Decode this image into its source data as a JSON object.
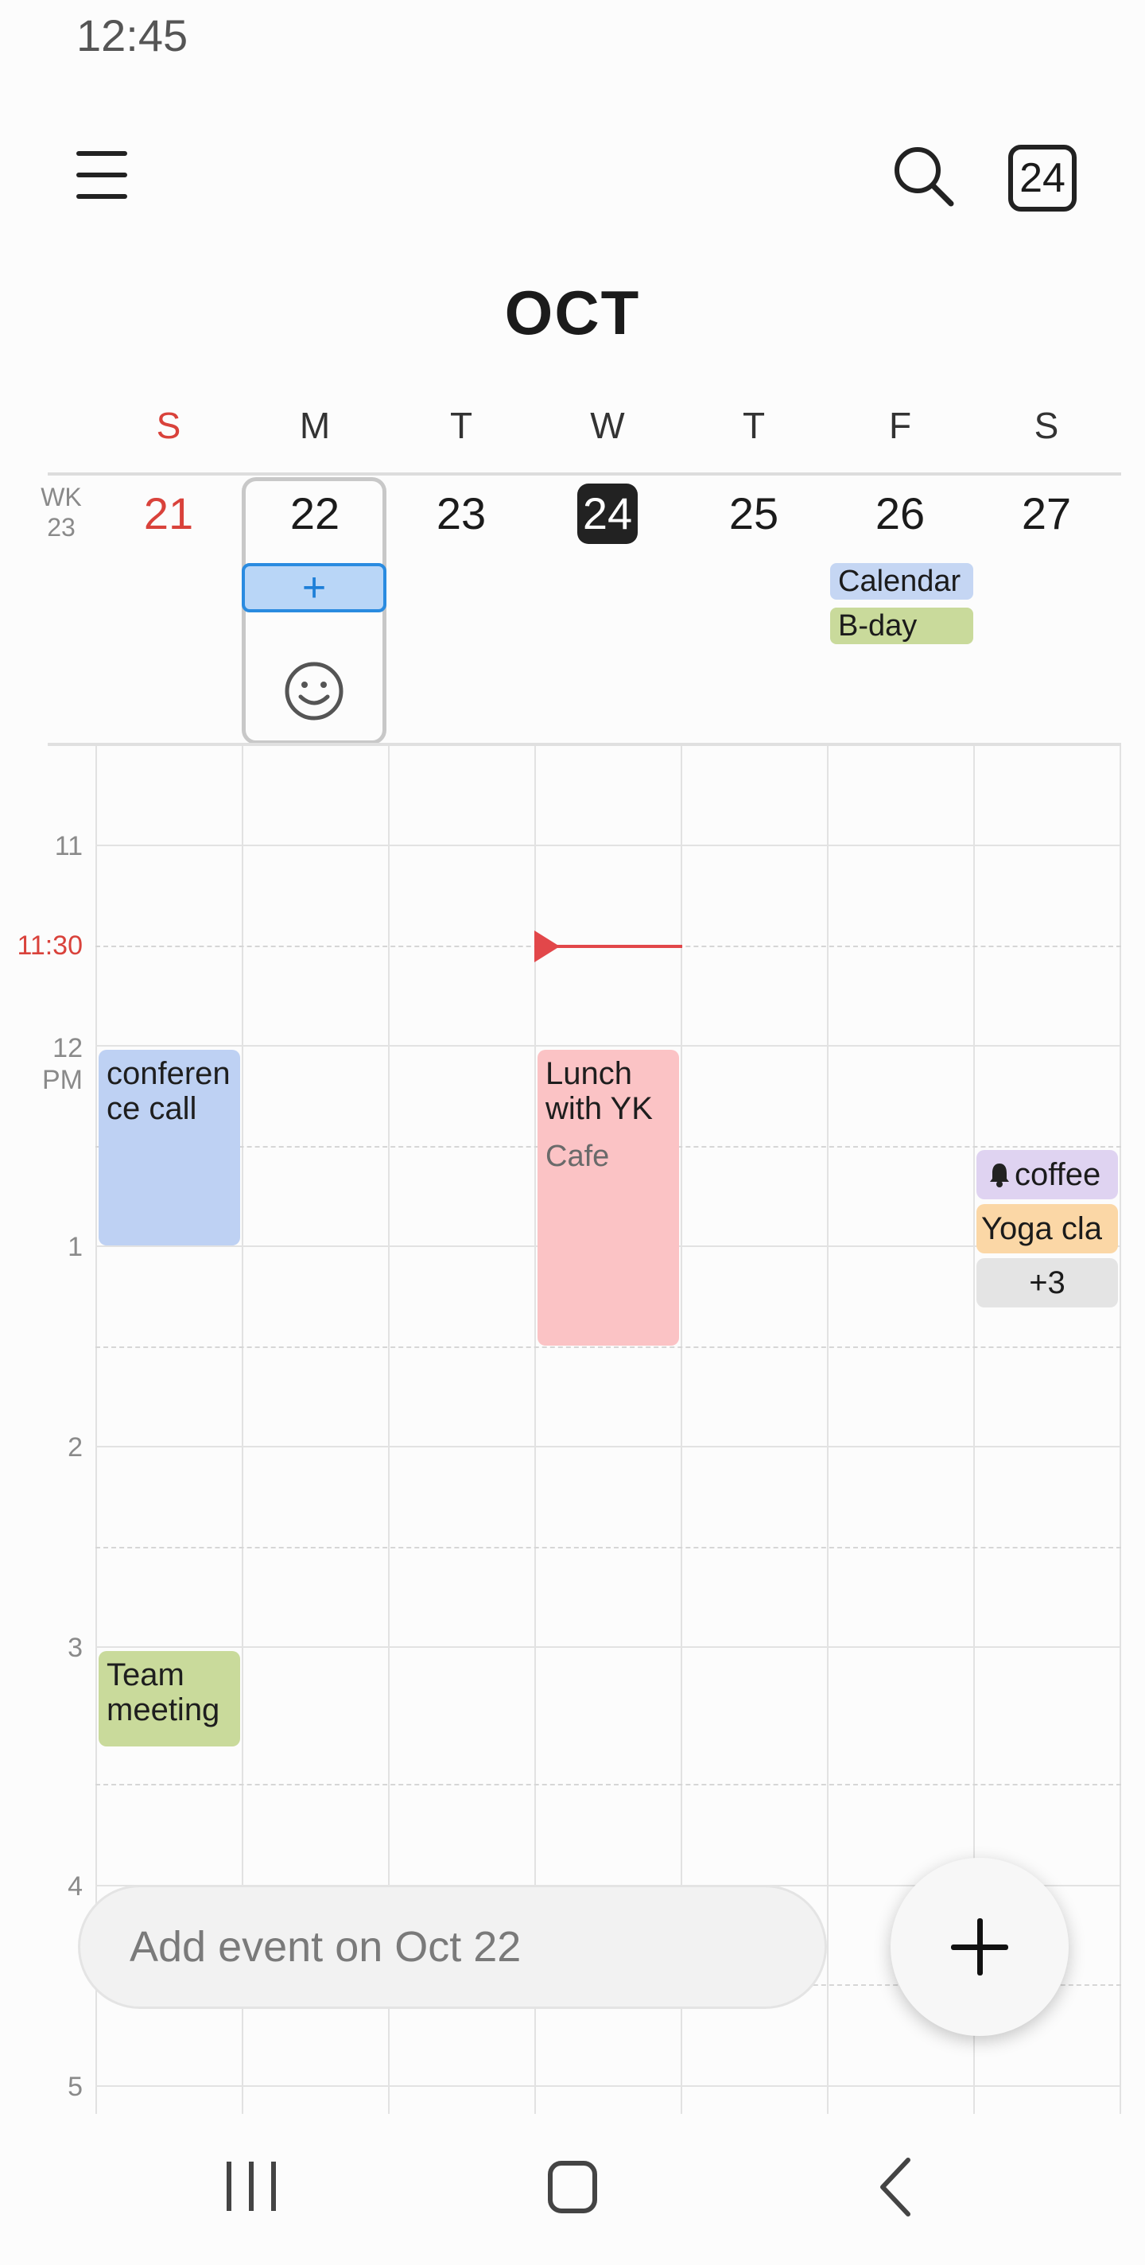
{
  "status_bar": {
    "time": "12:45"
  },
  "header": {
    "today_date": "24",
    "month": "OCT"
  },
  "week": {
    "week_label": "WK\n23",
    "day_letters": [
      "S",
      "M",
      "T",
      "W",
      "T",
      "F",
      "S"
    ],
    "dates": [
      "21",
      "22",
      "23",
      "24",
      "25",
      "26",
      "27"
    ],
    "selected_date": "22",
    "today": "24"
  },
  "all_day_events": [
    {
      "title": "Calendar",
      "day": "F",
      "color": "#c5d6f3"
    },
    {
      "title": "B-day",
      "day": "F",
      "color": "#c9da9b"
    }
  ],
  "hour_labels": [
    "11",
    "11:30",
    "12\nPM",
    "1",
    "2",
    "3",
    "4",
    "5"
  ],
  "events": [
    {
      "title": "conferen ce call",
      "day": "S",
      "color": "#bed1f3"
    },
    {
      "title": "Lunch with YK",
      "location": "Cafe",
      "day": "W",
      "color": "#fbc3c5"
    },
    {
      "title": "Team meeting",
      "day": "S",
      "color": "#c9da9b"
    },
    {
      "title": "coffee",
      "day": "S",
      "color": "#dfd3f1",
      "icon": "bell-icon"
    },
    {
      "title": "Yoga cla",
      "day": "S",
      "color": "#fbd7a6"
    },
    {
      "title": "+3",
      "day": "S",
      "color": "#e4e4e4"
    }
  ],
  "add_event": {
    "placeholder": "Add event on Oct 22"
  },
  "colors": {
    "sunday_red": "#d9423b",
    "now_line": "#e2474a",
    "selected_blue": "#2a8be0"
  }
}
